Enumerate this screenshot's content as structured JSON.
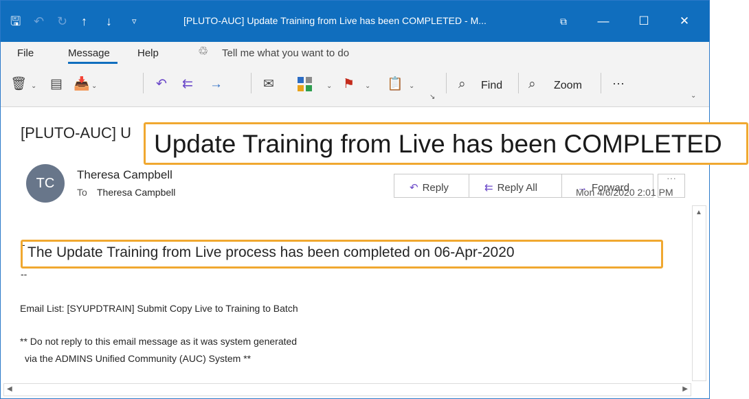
{
  "titlebar": {
    "title": "[PLUTO-AUC] Update Training from Live has been COMPLETED  -  M...",
    "icons": [
      "save-icon",
      "undo-icon",
      "redo-icon",
      "up-arrow-icon",
      "down-arrow-icon",
      "quick-access-icon",
      "restore-icon",
      "minimize-icon",
      "maximize-icon",
      "close-icon"
    ],
    "accent": "#106ebe"
  },
  "menu": {
    "file": "File",
    "message": "Message",
    "help": "Help",
    "tell_me": "Tell me what you want to do"
  },
  "ribbon": {
    "find": "Find",
    "zoom": "Zoom",
    "more": "···"
  },
  "message": {
    "subject_prefix": "[PLUTO-AUC] U",
    "sender_initials": "TC",
    "sender_name": "Theresa Campbell",
    "to_label": "To",
    "to_name": "Theresa Campbell",
    "reply": "Reply",
    "reply_all": "Reply All",
    "forward": "Forward",
    "date": "Mon 4/6/2020 2:01 PM"
  },
  "body": {
    "dash1": "-",
    "completed": "The Update Training from Live process has been completed on 06-Apr-2020",
    "dash2": "--",
    "email_list": "Email List: [SYUPDTRAIN] Submit Copy Live to Training to Batch",
    "notice1": "** Do not reply to this email message as it was system generated",
    "notice2": "via the ADMINS Unified Community (AUC) System **"
  },
  "callout": {
    "subject": "Update Training from Live has been COMPLETED",
    "color": "#f0a830"
  }
}
